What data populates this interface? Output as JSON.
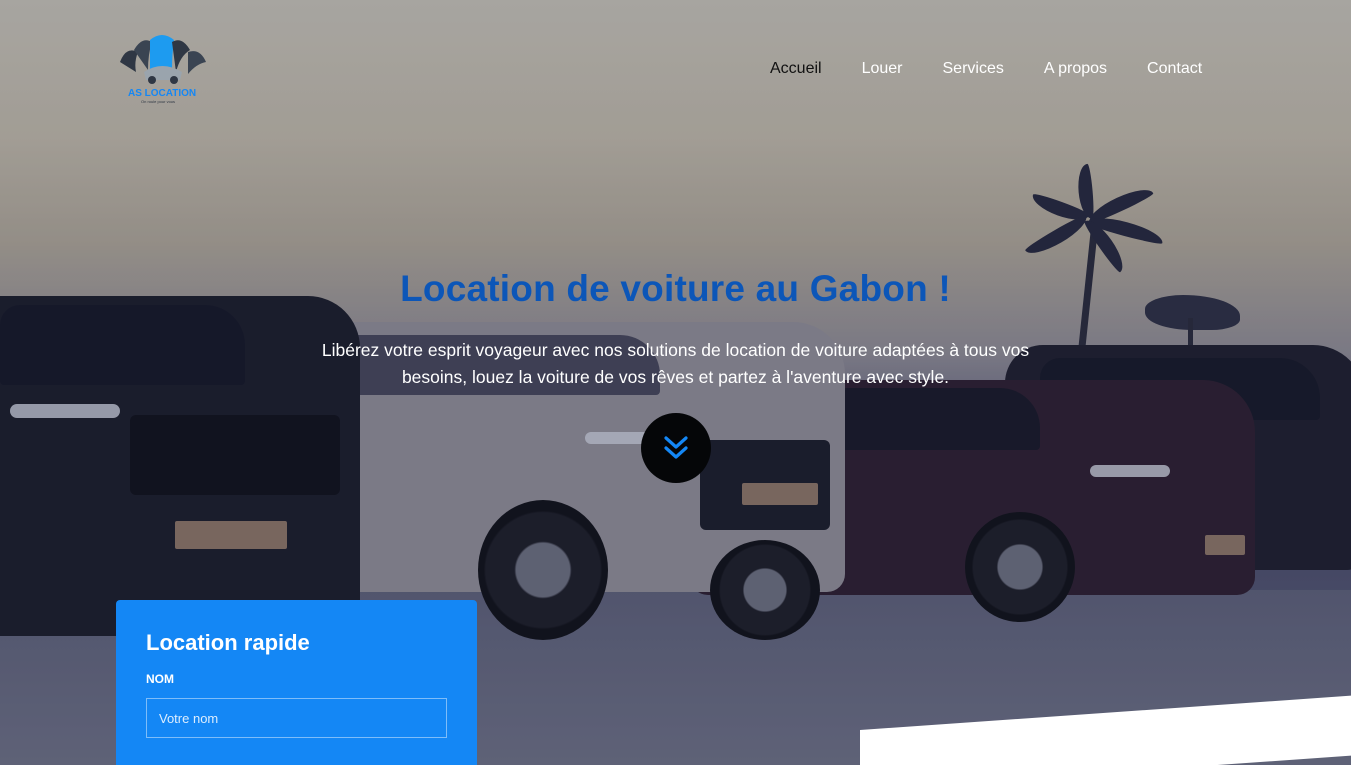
{
  "brand": {
    "name": "AS LOCATION",
    "tagline": "On roule pour vous"
  },
  "nav": {
    "items": [
      {
        "label": "Accueil",
        "active": true
      },
      {
        "label": "Louer",
        "active": false
      },
      {
        "label": "Services",
        "active": false
      },
      {
        "label": "A propos",
        "active": false
      },
      {
        "label": "Contact",
        "active": false
      }
    ]
  },
  "hero": {
    "title": "Location de voiture au Gabon !",
    "subtitle": "Libérez votre esprit voyageur avec nos solutions de location de voiture adaptées à tous vos besoins, louez la voiture de vos rêves et partez à l'aventure avec style.",
    "scroll_icon": "chevron-double-down-icon"
  },
  "quick_form": {
    "title": "Location rapide",
    "name_label": "NOM",
    "name_placeholder": "Votre nom"
  },
  "colors": {
    "accent": "#1487f5",
    "title_blue": "#0c56b8",
    "nav_active": "#111111",
    "nav_text": "#ffffff"
  }
}
